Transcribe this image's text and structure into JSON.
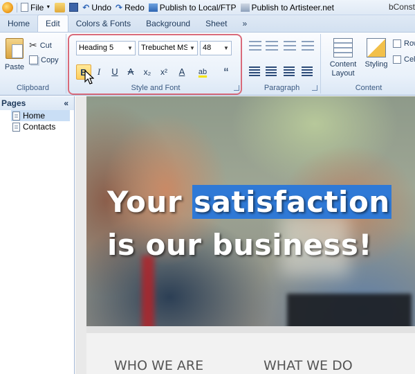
{
  "qat": {
    "file": "File",
    "undo": "Undo",
    "redo": "Redo",
    "publish_local": "Publish to Local/FTP",
    "publish_artisteer": "Publish to Artisteer.net",
    "window_title": "bConst"
  },
  "tabs": [
    "Home",
    "Edit",
    "Colors & Fonts",
    "Background",
    "Sheet",
    "»"
  ],
  "ribbon": {
    "clipboard": {
      "label": "Clipboard",
      "paste": "Paste",
      "cut": "Cut",
      "copy": "Copy"
    },
    "style_font": {
      "label": "Style and Font",
      "style_value": "Heading 5",
      "font_value": "Trebuchet MS",
      "size_value": "48",
      "bold": "B",
      "italic": "I",
      "underline": "U",
      "strike": "A",
      "subscript": "x₂",
      "superscript": "x²",
      "font_color": "A",
      "highlight": "ab",
      "quote": "“"
    },
    "paragraph": {
      "label": "Paragraph"
    },
    "content": {
      "label": "Content",
      "content_layout": "Content Layout",
      "styling": "Styling",
      "row": "Row",
      "cell": "Cel"
    }
  },
  "sidebar": {
    "title": "Pages",
    "collapse": "«",
    "pages": [
      "Home",
      "Contacts"
    ]
  },
  "canvas": {
    "headline_1_pre": "Your ",
    "headline_1_sel": "satisfaction",
    "headline_2": "is our business!",
    "section_1": "WHO WE ARE",
    "section_2": "WHAT WE DO"
  },
  "colors": {
    "selection": "#2f79d6",
    "ribbon_highlight_box": "#d96a7a",
    "bold_active": "#ffcf5c"
  }
}
